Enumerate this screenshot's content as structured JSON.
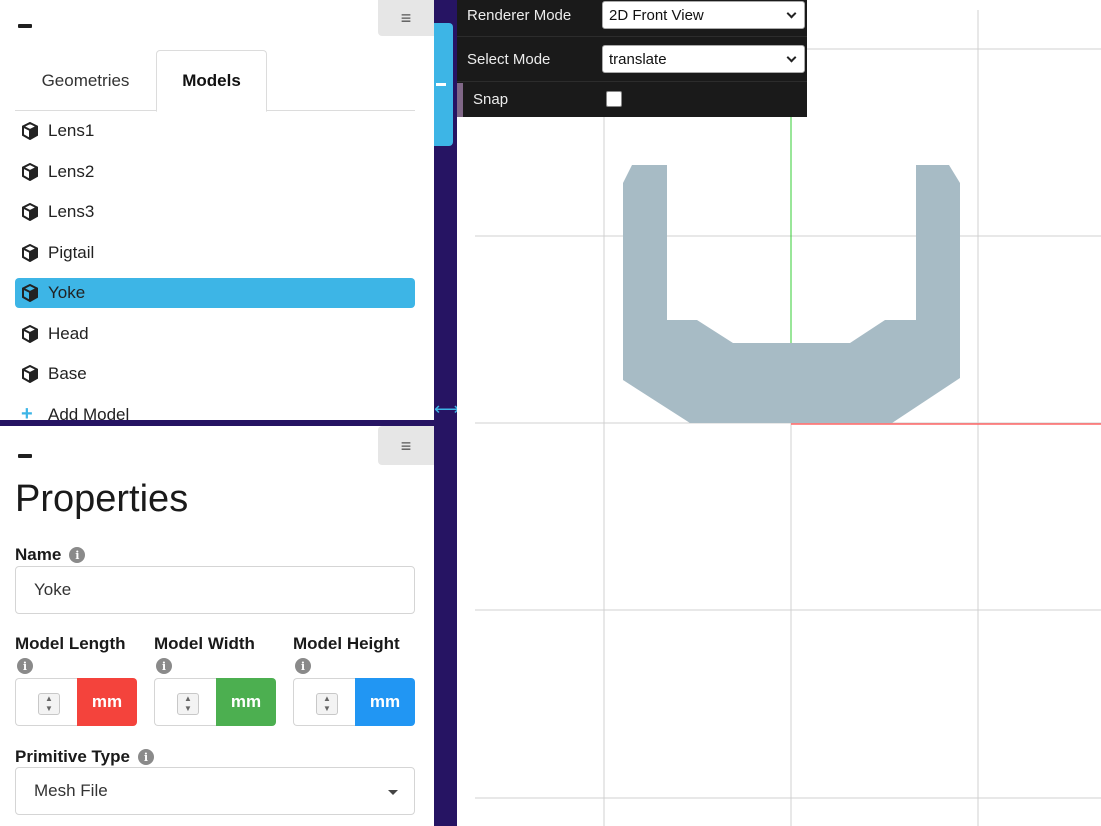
{
  "models_panel": {
    "tabs": [
      {
        "label": "Geometries",
        "active": false
      },
      {
        "label": "Models",
        "active": true
      }
    ],
    "items": [
      {
        "label": "Lens1",
        "icon": "cube-icon"
      },
      {
        "label": "Lens2",
        "icon": "cube-icon"
      },
      {
        "label": "Lens3",
        "icon": "cube-icon"
      },
      {
        "label": "Pigtail",
        "icon": "cube-icon"
      },
      {
        "label": "Yoke",
        "icon": "cube-icon",
        "selected": true
      },
      {
        "label": "Head",
        "icon": "cube-icon"
      },
      {
        "label": "Base",
        "icon": "cube-icon"
      }
    ],
    "add_label": "Add Model"
  },
  "properties": {
    "title": "Properties",
    "name_label": "Name",
    "name_value": "Yoke",
    "length_label": "Model Length",
    "width_label": "Model Width",
    "height_label": "Model Height",
    "unit": "mm",
    "unit_colors": {
      "length": "#f4433c",
      "width": "#4caf50",
      "height": "#2196f3"
    },
    "primitive_label": "Primitive Type",
    "primitive_value": "Mesh File"
  },
  "controls": {
    "renderer_label": "Renderer Mode",
    "renderer_value": "2D Front View",
    "select_label": "Select Mode",
    "select_value": "translate",
    "snap_label": "Snap",
    "snap_checked": false
  },
  "colors": {
    "accent": "#3db5e6",
    "dark_strip": "#261463",
    "model_fill": "#a7bbc5",
    "axis_y": "#33cc33",
    "axis_x": "#ff6666",
    "grid": "#d0d0d0"
  }
}
